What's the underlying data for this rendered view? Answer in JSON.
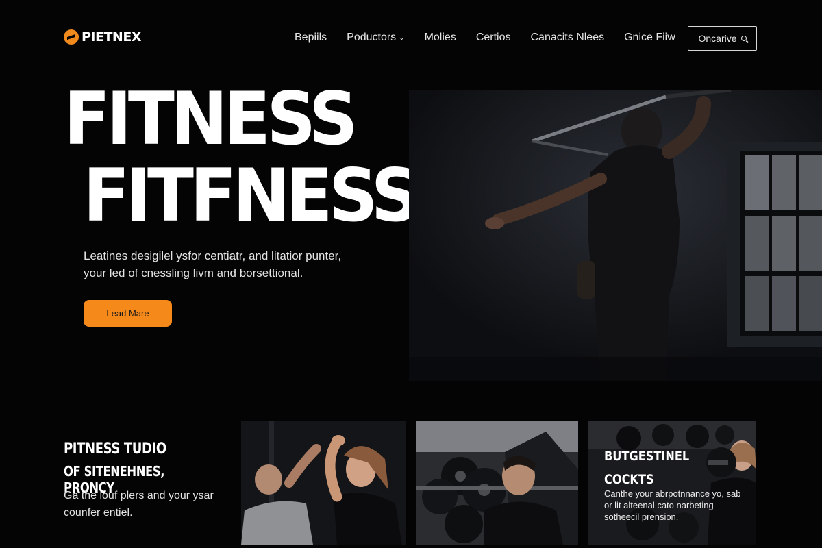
{
  "brand": {
    "name": "PIETNEX",
    "accent": "#f58a1b"
  },
  "nav": {
    "items": [
      "Bepiils",
      "Poductors",
      "Molies",
      "Certios",
      "Canacits Nlees",
      "Gnice Fiiw"
    ],
    "dropdown_item_index": 1,
    "button_label": "Oncarive",
    "button_icon": "search-icon"
  },
  "hero": {
    "title_line1": "FITNESS",
    "title_line2": "FITFNESS",
    "description": "Leatines desigilel ysfor centiatr, and litatior punter, your led of cnessling livm and borsettional.",
    "cta_label": "Lead Mare",
    "image_icon": "pull-up-athlete-photo"
  },
  "studio": {
    "title_line1": "PITNESS TUDIO",
    "title_line2": "OF SITENEHNES, PRONCY",
    "description": "Ga the louf plers and your ysar counfer entiel."
  },
  "tiles": [
    {
      "icon": "group-workout-photo"
    },
    {
      "icon": "weights-trainer-photo"
    },
    {
      "icon": "dumbbell-athlete-photo",
      "title_line1": "BUTGESTINEL",
      "title_line2": "COCKTS",
      "description": "Canthe your abrpotnnance yo, sab or lit alteenal cato narbeting sotheecil prension."
    }
  ]
}
